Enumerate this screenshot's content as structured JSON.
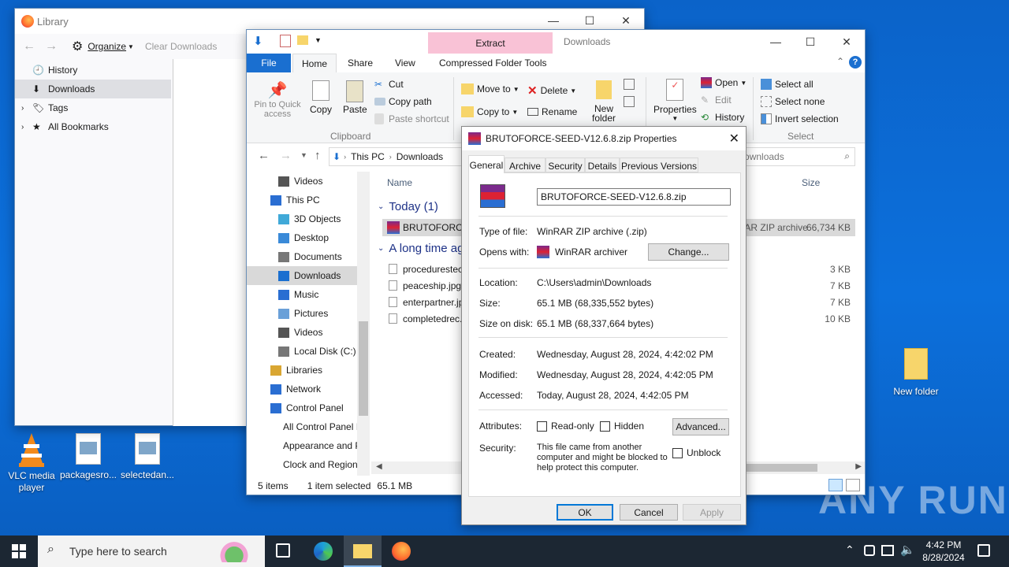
{
  "library": {
    "title": "Library",
    "organize": "Organize",
    "clear": "Clear Downloads",
    "items": [
      "History",
      "Downloads",
      "Tags",
      "All Bookmarks"
    ]
  },
  "explorer": {
    "title": "Downloads",
    "context_tab": "Extract",
    "context_group": "Compressed Folder Tools",
    "tabs": [
      "File",
      "Home",
      "Share",
      "View"
    ],
    "clipboard": {
      "pin": "Pin to Quick access",
      "copy": "Copy",
      "paste": "Paste",
      "cut": "Cut",
      "copy_path": "Copy path",
      "paste_shortcut": "Paste shortcut",
      "group": "Clipboard"
    },
    "organize": {
      "move_to": "Move to",
      "copy_to": "Copy to",
      "delete": "Delete",
      "rename": "Rename",
      "new_folder": "New folder"
    },
    "open_group": {
      "properties": "Properties",
      "open": "Open",
      "edit": "Edit",
      "history": "History"
    },
    "select_group": {
      "select_all": "Select all",
      "select_none": "Select none",
      "invert": "Invert selection",
      "group": "Select"
    },
    "address": [
      "This PC",
      "Downloads"
    ],
    "search_placeholder": "Search Downloads",
    "nav": [
      "Videos",
      "This PC",
      "3D Objects",
      "Desktop",
      "Documents",
      "Downloads",
      "Music",
      "Pictures",
      "Videos",
      "Local Disk (C:)",
      "Libraries",
      "Network",
      "Control Panel",
      "All Control Panel Items",
      "Appearance and Personalization",
      "Clock and Region"
    ],
    "columns": {
      "name": "Name",
      "size": "Size"
    },
    "groups": [
      "Today (1)",
      "A long time ago"
    ],
    "files": [
      {
        "name": "BRUTOFORCE-SEED-V12.6.8.zip",
        "type": "WinRAR ZIP archive",
        "size": "66,734 KB"
      },
      {
        "name": "procedurestech.jpg",
        "size": "3 KB"
      },
      {
        "name": "peaceship.jpg",
        "size": "7 KB"
      },
      {
        "name": "enterpartner.jpg",
        "size": "7 KB"
      },
      {
        "name": "completedrec.jpg",
        "size": "10 KB"
      }
    ],
    "status": {
      "items": "5 items",
      "selected": "1 item selected",
      "size": "65.1 MB"
    }
  },
  "props": {
    "title": "BRUTOFORCE-SEED-V12.6.8.zip Properties",
    "tabs": [
      "General",
      "Archive",
      "Security",
      "Details",
      "Previous Versions"
    ],
    "filename": "BRUTOFORCE-SEED-V12.6.8.zip",
    "type_label": "Type of file:",
    "type": "WinRAR ZIP archive (.zip)",
    "opens_label": "Opens with:",
    "opens": "WinRAR archiver",
    "change": "Change...",
    "location_label": "Location:",
    "location": "C:\\Users\\admin\\Downloads",
    "size_label": "Size:",
    "size": "65.1 MB (68,335,552 bytes)",
    "disk_label": "Size on disk:",
    "disk": "65.1 MB (68,337,664 bytes)",
    "created_label": "Created:",
    "created": "Wednesday, August 28, 2024, 4:42:02 PM",
    "modified_label": "Modified:",
    "modified": "Wednesday, August 28, 2024, 4:42:05 PM",
    "accessed_label": "Accessed:",
    "accessed": "Today, August 28, 2024, 4:42:05 PM",
    "attr_label": "Attributes:",
    "readonly": "Read-only",
    "hidden": "Hidden",
    "advanced": "Advanced...",
    "security_label": "Security:",
    "security": "This file came from another computer and might be blocked to help protect this computer.",
    "unblock": "Unblock",
    "ok": "OK",
    "cancel": "Cancel",
    "apply": "Apply"
  },
  "desktop": {
    "icons": [
      "VLC media player",
      "packagesro...",
      "selectedan...",
      "New folder"
    ]
  },
  "taskbar": {
    "search": "Type here to search",
    "time": "4:42 PM",
    "date": "8/28/2024"
  },
  "watermark": "ANY RUN",
  "colors": {
    "desktop": "#0c70dc",
    "accent": "#1a6fd0",
    "context_tab": "#f9c2d6",
    "selection": "#cce8ff"
  }
}
